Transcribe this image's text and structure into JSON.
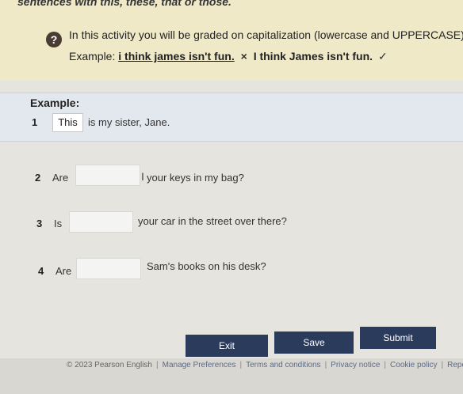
{
  "header": {
    "title": "sentences with this, these, that or those.",
    "help_icon": "?",
    "instructions": "In this activity you will be graded on capitalization (lowercase and UPPERCASE).",
    "example_label": "Example:",
    "example_wrong": "i think james isn't fun.",
    "example_cross": "×",
    "example_right": "I think James isn't fun.",
    "example_tick": "✓"
  },
  "example": {
    "heading": "Example:",
    "number": "1",
    "answer": "This",
    "rest": "is my sister, Jane."
  },
  "questions": [
    {
      "number": "2",
      "pre": "Are",
      "post": "your keys in my bag?",
      "value": ""
    },
    {
      "number": "3",
      "pre": "Is",
      "post": "your car in the street over there?",
      "value": ""
    },
    {
      "number": "4",
      "pre": "Are",
      "post": "Sam's books on his desk?",
      "value": ""
    }
  ],
  "buttons": {
    "exit": "Exit",
    "save": "Save",
    "submit": "Submit"
  },
  "footer": {
    "copyright": "© 2023 Pearson English",
    "links": [
      "Manage Preferences",
      "Terms and conditions",
      "Privacy notice",
      "Cookie policy",
      "Repo"
    ]
  },
  "colors": {
    "button_bg": "#2b3b5c",
    "banner_bg": "#efe9c8",
    "example_bg": "#e3e8ee"
  }
}
